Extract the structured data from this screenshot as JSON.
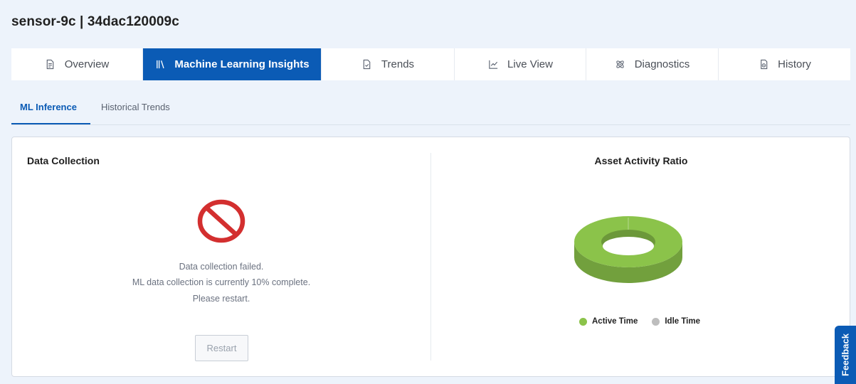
{
  "header": {
    "title": "sensor-9c | 34dac120009c"
  },
  "tabs": [
    {
      "label": "Overview",
      "icon": "document-icon"
    },
    {
      "label": "Machine Learning Insights",
      "icon": "library-icon",
      "active": true
    },
    {
      "label": "Trends",
      "icon": "file-check-icon"
    },
    {
      "label": "Live View",
      "icon": "line-chart-icon"
    },
    {
      "label": "Diagnostics",
      "icon": "atom-icon"
    },
    {
      "label": "History",
      "icon": "history-icon"
    }
  ],
  "subtabs": [
    {
      "label": "ML Inference",
      "active": true
    },
    {
      "label": "Historical Trends"
    }
  ],
  "data_collection": {
    "title": "Data Collection",
    "status_icon": "no-entry-icon",
    "messages": [
      "Data collection failed.",
      "ML data collection is currently 10% complete.",
      "Please restart."
    ],
    "progress_percent": 10,
    "restart_label": "Restart"
  },
  "activity": {
    "title": "Asset Activity Ratio",
    "legend": [
      {
        "label": "Active Time",
        "color": "#8bc34a"
      },
      {
        "label": "Idle Time",
        "color": "#bdbdbd"
      }
    ]
  },
  "chart_data": {
    "type": "pie",
    "title": "Asset Activity Ratio",
    "categories": [
      "Active Time",
      "Idle Time"
    ],
    "values": [
      100,
      0
    ],
    "colors": [
      "#8bc34a",
      "#bdbdbd"
    ]
  },
  "feedback": {
    "label": "Feedback"
  },
  "colors": {
    "accent": "#0b5bb5",
    "error": "#d32f2f",
    "active": "#8bc34a",
    "idle": "#bdbdbd"
  }
}
